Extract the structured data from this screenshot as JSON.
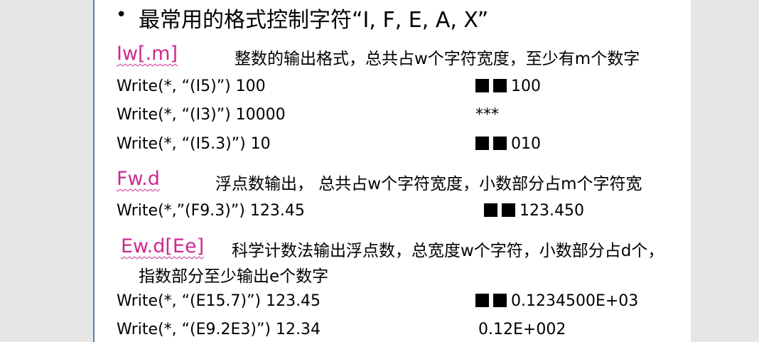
{
  "bullet": "•",
  "title": "最常用的格式控制字符“I, F, E, A, X”",
  "sections": [
    {
      "heading": "Iw[.m]",
      "description": "整数的输出格式，总共占w个字符宽度，至少有m个数字",
      "examples": [
        {
          "code": "Write(*, “(I5)”)   100",
          "filled_squares": 2,
          "output": "100"
        },
        {
          "code": "Write(*, “(I3)”)   10000",
          "filled_squares": 0,
          "output": "***"
        },
        {
          "code": "Write(*, “(I5.3)”)   10",
          "filled_squares": 2,
          "output": "010"
        }
      ]
    },
    {
      "heading": "Fw.d",
      "description": "浮点数输出， 总共占w个字符宽度，小数部分占m个字符宽",
      "examples": [
        {
          "code": "Write(*,”(F9.3)”)  123.45",
          "filled_squares": 2,
          "output": "123.450"
        }
      ]
    },
    {
      "heading": "Ew.d[Ee]",
      "description": "科学计数法输出浮点数，总宽度w个字符，小数部分占d个，",
      "description_continued": "指数部分至少输出e个数字",
      "examples": [
        {
          "code": "Write(*, “(E15.7)”)  123.45",
          "filled_squares": 2,
          "output": "0.1234500E+03"
        },
        {
          "code": "Write(*, “(E9.2E3)”)  12.34",
          "filled_squares": 0,
          "output": "0.12E+002"
        }
      ]
    }
  ]
}
